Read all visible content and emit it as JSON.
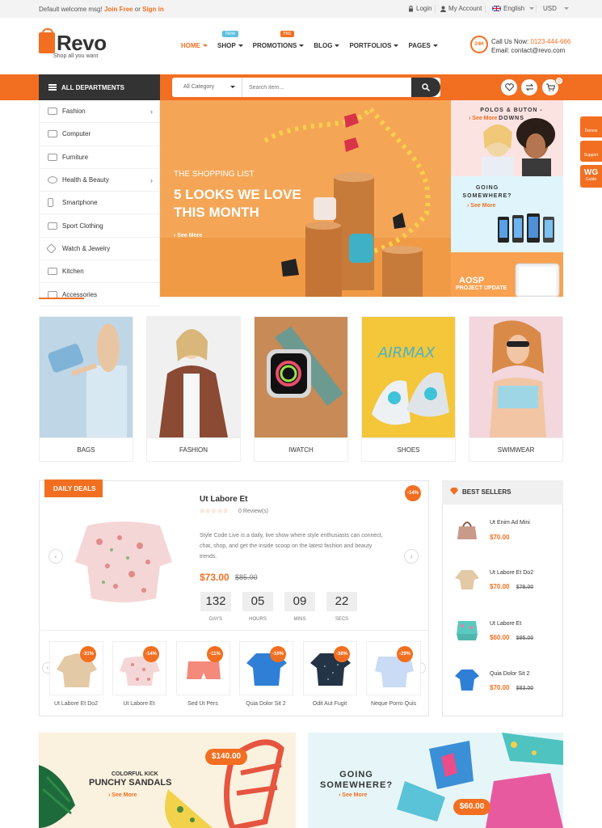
{
  "topbar": {
    "welcome": "Default welcome msg!",
    "join": "Join Free",
    "or": "or",
    "signin": "Sign in",
    "login": "Login",
    "account": "My Account",
    "language": "English",
    "currency": "USD"
  },
  "brand": {
    "name": "Revo",
    "tagline": "Shop all you want",
    "accent": "#f26f21"
  },
  "nav": {
    "items": [
      {
        "label": "HOME",
        "badge": ""
      },
      {
        "label": "SHOP",
        "badge": "New"
      },
      {
        "label": "PROMOTIONS",
        "badge": "Hot"
      },
      {
        "label": "BLOG",
        "badge": ""
      },
      {
        "label": "PORTFOLIOS",
        "badge": ""
      },
      {
        "label": "PAGES",
        "badge": ""
      }
    ]
  },
  "contact": {
    "call_label": "Call Us Now:",
    "phone": "0123-444-666",
    "email": "Email: contact@revo.com",
    "icon_text": "24H"
  },
  "departments": {
    "title": "ALL DEPARTMENTS",
    "items": [
      "Fashion",
      "Computer",
      "Furniture",
      "Health & Beauty",
      "Smartphone",
      "Sport Clothing",
      "Watch & Jewelry",
      "Kitchen",
      "Accessories"
    ]
  },
  "search": {
    "category": "All Category",
    "placeholder": "Search item..."
  },
  "cart": {
    "count": "0"
  },
  "side_tabs": [
    "Demos",
    "Support",
    "Guide"
  ],
  "hero": {
    "subtitle": "THE SHOPPING LIST",
    "title": "5 LOOKS WE LOVE THIS MONTH",
    "link": "See More"
  },
  "promos": [
    {
      "title": "POLOS & BUTON - DOWNS",
      "link": "See More"
    },
    {
      "title": "GOING SOMEWHERE?",
      "link": "See More"
    },
    {
      "title": "AOSP",
      "subtitle": "PROJECT UPDATE"
    }
  ],
  "categories": [
    "BAGS",
    "FASHION",
    "IWATCH",
    "SHOES",
    "SWIMWEAR"
  ],
  "deals": {
    "tag": "DAILY DEALS",
    "title": "Ut Labore Et",
    "stars": "☆☆☆☆☆",
    "reviews": "0 Review(s)",
    "discount": "-14%",
    "description": "Style Code Live is a daily, live show where style enthusiasts can connect, chat, shop, and get the inside scoop on the latest fashion and beauty trends.",
    "price": "$73.00",
    "old_price": "$85.00",
    "countdown": [
      {
        "value": "132",
        "label": "DAYS"
      },
      {
        "value": "05",
        "label": "HOURS"
      },
      {
        "value": "09",
        "label": "MINS"
      },
      {
        "value": "22",
        "label": "SECS"
      }
    ],
    "products": [
      {
        "name": "Ut Labore Et Do2",
        "discount": "-31%"
      },
      {
        "name": "Ut Labore Et",
        "discount": "-14%"
      },
      {
        "name": "Sed Ut Pers",
        "discount": "-11%"
      },
      {
        "name": "Quia Dolor Sit 2",
        "discount": "-16%"
      },
      {
        "name": "Odit Aut Fugit",
        "discount": "-38%"
      },
      {
        "name": "Neque Porro Quis",
        "discount": "-29%"
      }
    ]
  },
  "best_sellers": {
    "title": "BEST SELLERS",
    "items": [
      {
        "name": "Ut Enim Ad Mini",
        "price": "$70.00",
        "old_price": ""
      },
      {
        "name": "Ut Labore Et Do2",
        "price": "$70.00",
        "old_price": "$79.00"
      },
      {
        "name": "Ut Labore Et",
        "price": "$60.00",
        "old_price": "$95.00"
      },
      {
        "name": "Quia Dolor Sit 2",
        "price": "$70.00",
        "old_price": "$83.00"
      }
    ]
  },
  "banners": [
    {
      "kicker": "COLORFUL KICK",
      "title": "PUNCHY SANDALS",
      "link": "See More",
      "price": "$140.00"
    },
    {
      "title": "GOING SOMEWHERE?",
      "link": "See More",
      "price": "$60.00"
    }
  ]
}
